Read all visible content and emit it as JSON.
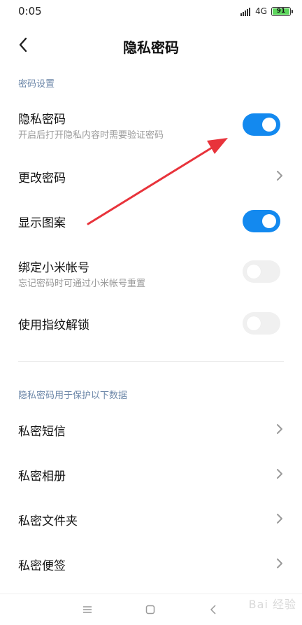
{
  "status_bar": {
    "time": "0:05",
    "network": "4G",
    "battery": "91"
  },
  "header": {
    "title": "隐私密码"
  },
  "sections": {
    "password_settings": {
      "label": "密码设置"
    },
    "protected_data": {
      "label": "隐私密码用于保护以下数据"
    }
  },
  "settings": {
    "privacy_password": {
      "title": "隐私密码",
      "subtitle": "开启后打开隐私内容时需要验证密码",
      "enabled": true
    },
    "change_password": {
      "title": "更改密码"
    },
    "show_pattern": {
      "title": "显示图案",
      "enabled": true
    },
    "bind_mi_account": {
      "title": "绑定小米帐号",
      "subtitle": "忘记密码时可通过小米帐号重置",
      "enabled": false
    },
    "fingerprint_unlock": {
      "title": "使用指纹解锁",
      "enabled": false
    }
  },
  "protected_items": [
    {
      "title": "私密短信"
    },
    {
      "title": "私密相册"
    },
    {
      "title": "私密文件夹"
    },
    {
      "title": "私密便签"
    }
  ],
  "colors": {
    "accent": "#1389ef",
    "section_header": "#6b86a8",
    "annotation_arrow": "#e8333b"
  },
  "watermark": {
    "text": "Bai 经验"
  }
}
